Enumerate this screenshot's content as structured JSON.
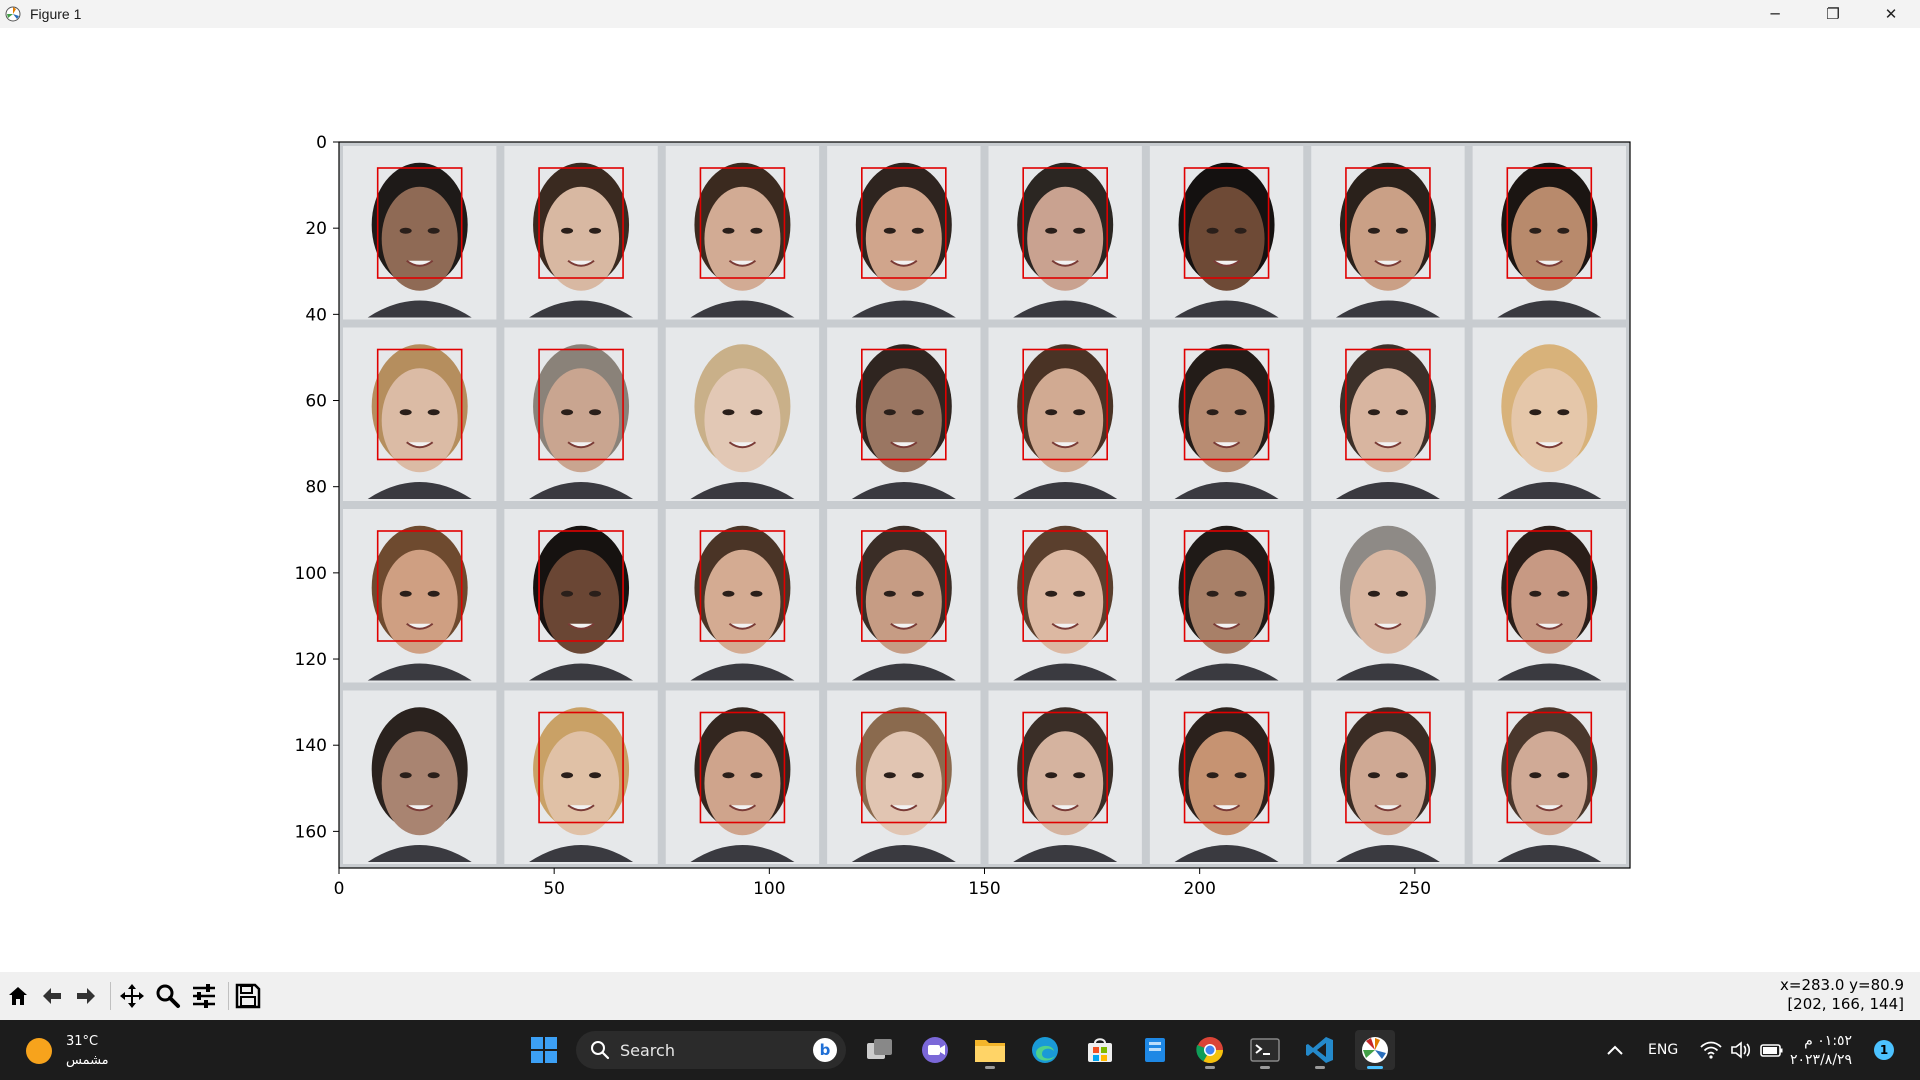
{
  "window": {
    "title": "Figure 1",
    "controls": [
      "─",
      "❐",
      "✕"
    ]
  },
  "figure": {
    "image": "grid of 32 face portraits (4 rows × 8 columns) with red face-detection boxes",
    "box_color": "#e00000",
    "x_ticks": [
      "0",
      "50",
      "100",
      "150",
      "200",
      "250"
    ],
    "y_ticks": [
      "0",
      "20",
      "40",
      "60",
      "80",
      "100",
      "120",
      "140",
      "160"
    ],
    "faces": [
      {
        "tone": "#8f6a55",
        "hair": "#1e1a18",
        "boxed": true
      },
      {
        "tone": "#d8b8a2",
        "hair": "#3a2a20",
        "boxed": true
      },
      {
        "tone": "#d2ab94",
        "hair": "#3b2a1f",
        "boxed": true
      },
      {
        "tone": "#d0a58c",
        "hair": "#2e241f",
        "boxed": true
      },
      {
        "tone": "#c9a290",
        "hair": "#2b2622",
        "boxed": true
      },
      {
        "tone": "#6e4a36",
        "hair": "#141110",
        "boxed": true
      },
      {
        "tone": "#caa086",
        "hair": "#2a211b",
        "boxed": true
      },
      {
        "tone": "#b88a6c",
        "hair": "#1b1512",
        "boxed": true
      },
      {
        "tone": "#dbbba5",
        "hair": "#b58e5e",
        "boxed": true
      },
      {
        "tone": "#c9a590",
        "hair": "#8a8279",
        "boxed": true
      },
      {
        "tone": "#e2c8b5",
        "hair": "#c9b089",
        "boxed": false
      },
      {
        "tone": "#9a7662",
        "hair": "#2f2520",
        "boxed": true
      },
      {
        "tone": "#d1aa92",
        "hair": "#4a3325",
        "boxed": true
      },
      {
        "tone": "#b88c72",
        "hair": "#231c18",
        "boxed": true
      },
      {
        "tone": "#d8b5a0",
        "hair": "#3c3029",
        "boxed": true
      },
      {
        "tone": "#e5c7aa",
        "hair": "#d8b27a",
        "boxed": false
      },
      {
        "tone": "#cf9f82",
        "hair": "#6e4a2f",
        "boxed": true
      },
      {
        "tone": "#6a4634",
        "hair": "#161210",
        "boxed": true
      },
      {
        "tone": "#d4ab92",
        "hair": "#4a3426",
        "boxed": true
      },
      {
        "tone": "#c69c84",
        "hair": "#3a2d26",
        "boxed": true
      },
      {
        "tone": "#dcb8a2",
        "hair": "#5a3f2d",
        "boxed": true
      },
      {
        "tone": "#a88068",
        "hair": "#1f1a17",
        "boxed": true
      },
      {
        "tone": "#d9b7a2",
        "hair": "#8e8a86",
        "boxed": false
      },
      {
        "tone": "#c79983",
        "hair": "#2a1e19",
        "boxed": true
      },
      {
        "tone": "#a98471",
        "hair": "#2a221e",
        "boxed": false
      },
      {
        "tone": "#e0c1a6",
        "hair": "#c9a166",
        "boxed": true
      },
      {
        "tone": "#cfa48c",
        "hair": "#33261f",
        "boxed": true
      },
      {
        "tone": "#e1c5b2",
        "hair": "#8a6a4e",
        "boxed": true
      },
      {
        "tone": "#d5b39f",
        "hair": "#3a2e27",
        "boxed": true
      },
      {
        "tone": "#c69372",
        "hair": "#2b211c",
        "boxed": true
      },
      {
        "tone": "#cfa994",
        "hair": "#3a2c24",
        "boxed": true
      },
      {
        "tone": "#d0aa96",
        "hair": "#4a372c",
        "boxed": true
      }
    ]
  },
  "toolbar": {
    "buttons": [
      "home-icon",
      "back-icon",
      "forward-icon",
      "pan-icon",
      "zoom-icon",
      "configure-subplots-icon",
      "save-icon"
    ],
    "coord_line1": "x=283.0 y=80.9",
    "coord_line2": "[202, 166, 144]"
  },
  "taskbar": {
    "temperature": "31°C",
    "weather_desc": "مشمس",
    "search_label": "Search",
    "language": "ENG",
    "time": "٠١:٥٢ م",
    "date": "٢٠٢٣/٨/٢٩",
    "notification_count": "1",
    "apps": [
      "start-icon",
      "task-view-icon",
      "teams-icon",
      "file-explorer-icon",
      "edge-icon",
      "store-icon",
      "blue-app-icon",
      "chrome-icon",
      "terminal-icon",
      "vscode-icon",
      "matplotlib-icon"
    ]
  }
}
